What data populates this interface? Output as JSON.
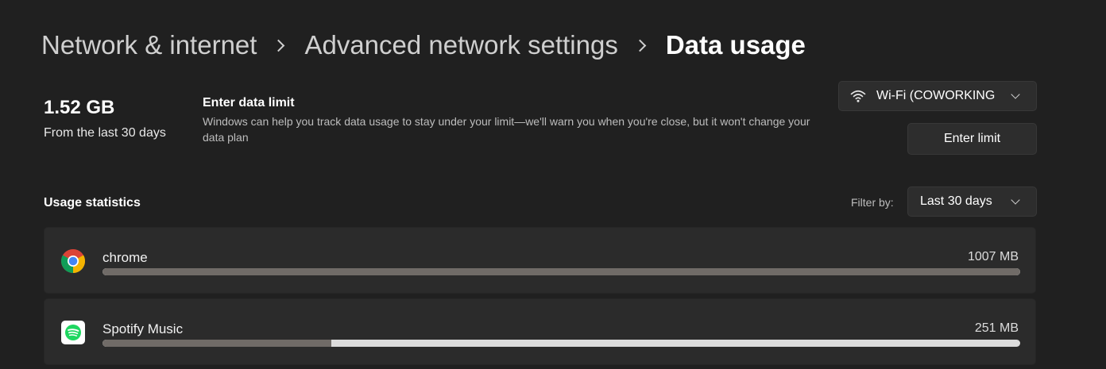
{
  "breadcrumb": {
    "items": [
      "Network & internet",
      "Advanced network settings"
    ],
    "current": "Data usage"
  },
  "summary": {
    "total": "1.52 GB",
    "period": "From the last 30 days"
  },
  "data_limit": {
    "title": "Enter data limit",
    "description": "Windows can help you track data usage to stay under your limit—we'll warn you when you're close, but it won't change your data plan",
    "button_label": "Enter limit"
  },
  "network_selector": {
    "icon": "wifi-icon",
    "selected": "Wi-Fi (COWORKING"
  },
  "usage_statistics": {
    "title": "Usage statistics",
    "filter_label": "Filter by:",
    "filter_selected": "Last 30 days",
    "apps": [
      {
        "name": "chrome",
        "size": "1007 MB",
        "icon": "chrome-icon",
        "share": 1.0
      },
      {
        "name": "Spotify Music",
        "size": "251 MB",
        "icon": "spotify-icon",
        "share": 0.249
      }
    ]
  },
  "colors": {
    "background": "#202020",
    "card": "#2b2b2b",
    "bar_fill": "#706b67",
    "bar_track": "#dcdcdc",
    "spotify_green": "#1ed760"
  }
}
